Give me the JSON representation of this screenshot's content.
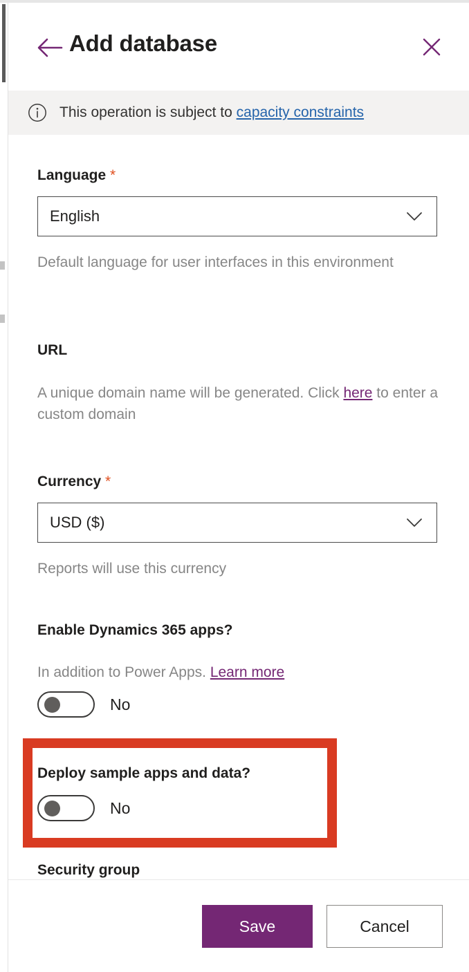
{
  "panel": {
    "title": "Add database",
    "back_icon": "arrow-left-icon",
    "close_icon": "close-icon",
    "accent_color": "#742774"
  },
  "infobar": {
    "icon": "info-circle-icon",
    "text": "This operation is subject to ",
    "link_label": "capacity constraints",
    "link_color": "#2564ab",
    "background": "#f3f2f1"
  },
  "fields": {
    "language": {
      "label": "Language",
      "required_marker": "*",
      "value": "English",
      "hint": "Default language for user interfaces in this environment",
      "chevron_icon": "chevron-down-icon"
    },
    "url": {
      "label": "URL",
      "hint_before": "A unique domain name will be generated. Click ",
      "hint_link": "here",
      "hint_after": " to enter a custom domain"
    },
    "currency": {
      "label": "Currency",
      "required_marker": "*",
      "value": "USD ($)",
      "hint": "Reports will use this currency",
      "chevron_icon": "chevron-down-icon"
    },
    "dynamics": {
      "label": "Enable Dynamics 365 apps?",
      "hint_before": "In addition to Power Apps. ",
      "hint_link": "Learn more",
      "toggle_state": "No"
    },
    "sample_apps": {
      "label": "Deploy sample apps and data?",
      "toggle_state": "No"
    },
    "security_group": {
      "label": "Security group"
    }
  },
  "highlight": {
    "name": "deploy-sample-apps-highlight",
    "color": "#d93b22"
  },
  "footer": {
    "save_label": "Save",
    "cancel_label": "Cancel"
  }
}
